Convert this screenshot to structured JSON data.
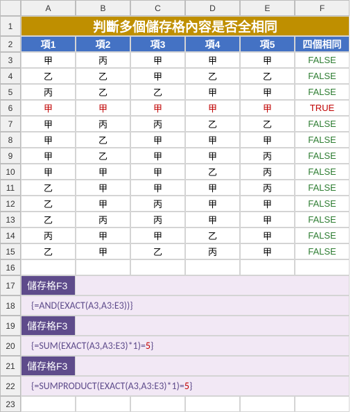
{
  "columns": [
    "A",
    "B",
    "C",
    "D",
    "E",
    "F"
  ],
  "rownums": [
    "1",
    "2",
    "3",
    "4",
    "5",
    "6",
    "7",
    "8",
    "9",
    "10",
    "11",
    "12",
    "13",
    "14",
    "15",
    "16",
    "17",
    "18",
    "19",
    "20",
    "21",
    "22",
    "23"
  ],
  "title": "判斷多個儲存格內容是否全相同",
  "headers": [
    "項1",
    "項2",
    "項3",
    "項4",
    "項5",
    "四個相同"
  ],
  "rows": [
    {
      "c": [
        "甲",
        "丙",
        "甲",
        "甲",
        "甲"
      ],
      "r": "FALSE",
      "red": false
    },
    {
      "c": [
        "乙",
        "乙",
        "甲",
        "乙",
        "乙"
      ],
      "r": "FALSE",
      "red": false
    },
    {
      "c": [
        "丙",
        "乙",
        "乙",
        "甲",
        "甲"
      ],
      "r": "FALSE",
      "red": false
    },
    {
      "c": [
        "甲",
        "甲",
        "甲",
        "甲",
        "甲"
      ],
      "r": "TRUE",
      "red": true
    },
    {
      "c": [
        "甲",
        "丙",
        "丙",
        "乙",
        "乙"
      ],
      "r": "FALSE",
      "red": false
    },
    {
      "c": [
        "甲",
        "乙",
        "甲",
        "甲",
        "甲"
      ],
      "r": "FALSE",
      "red": false
    },
    {
      "c": [
        "甲",
        "乙",
        "甲",
        "甲",
        "丙"
      ],
      "r": "FALSE",
      "red": false
    },
    {
      "c": [
        "甲",
        "甲",
        "甲",
        "乙",
        "丙"
      ],
      "r": "FALSE",
      "red": false
    },
    {
      "c": [
        "乙",
        "甲",
        "甲",
        "甲",
        "丙"
      ],
      "r": "FALSE",
      "red": false
    },
    {
      "c": [
        "乙",
        "甲",
        "丙",
        "甲",
        "甲"
      ],
      "r": "FALSE",
      "red": false
    },
    {
      "c": [
        "乙",
        "丙",
        "丙",
        "甲",
        "甲"
      ],
      "r": "FALSE",
      "red": false
    },
    {
      "c": [
        "丙",
        "甲",
        "甲",
        "乙",
        "甲"
      ],
      "r": "FALSE",
      "red": false
    },
    {
      "c": [
        "乙",
        "甲",
        "乙",
        "丙",
        "甲"
      ],
      "r": "FALSE",
      "red": false
    }
  ],
  "label1": "儲存格F3",
  "f1": "{=AND(EXACT(A3,A3:E3))}",
  "label2": "儲存格F3",
  "f2a": "{=SUM(EXACT(A3,A3:E3)*1)=",
  "f2b": "5",
  "f2c": "}",
  "label3": "儲存格F3",
  "f3a": "{=SUMPRODUCT(EXACT(A3,A3:E3)*1)=",
  "f3b": "5",
  "f3c": "}"
}
